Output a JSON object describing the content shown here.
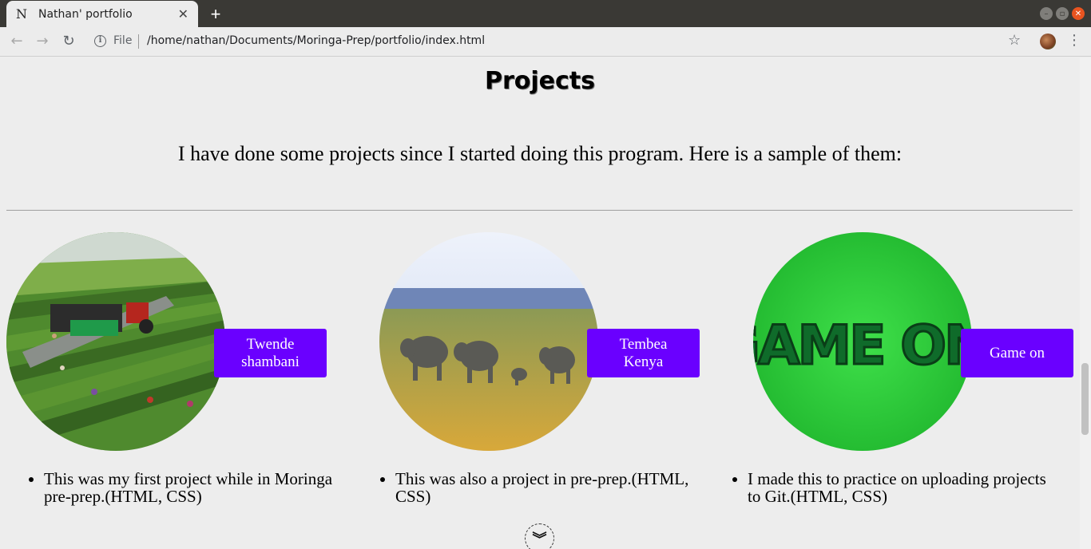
{
  "browser": {
    "tab_title": "Nathan' portfolio",
    "favicon_letter": "N",
    "tab_close": "✕",
    "new_tab": "+",
    "file_label": "File",
    "url": "/home/nathan/Documents/Moringa-Prep/portfolio/index.html",
    "back": "←",
    "forward": "→",
    "reload": "↻",
    "info": "i",
    "star": "☆",
    "menu": "⋮",
    "window_buttons": [
      "–",
      "▫",
      "✕"
    ]
  },
  "section": {
    "title": "Projects",
    "intro": "I have done some projects since I started doing this program. Here is a sample of them:"
  },
  "projects": [
    {
      "button": "Twende shambani",
      "description": "This was my first project while in Moringa pre-prep.(HTML, CSS)",
      "image": "farm-field-image"
    },
    {
      "button": "Tembea Kenya",
      "description": "This was also a project in pre-prep.(HTML, CSS)",
      "image": "elephants-savanna-image"
    },
    {
      "button": "Game on",
      "description": "I made this to practice on uploading projects to Git.(HTML, CSS)",
      "image": "game-on-image",
      "image_text": "GAME ON!"
    }
  ],
  "scroll_down": "︾",
  "colors": {
    "accent_button": "#6a00ff",
    "page_bg": "#ededed"
  }
}
